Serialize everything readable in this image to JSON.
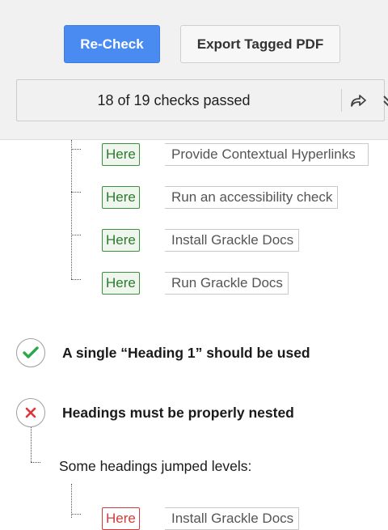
{
  "toolbar": {
    "recheck_label": "Re-Check",
    "export_label": "Export Tagged PDF"
  },
  "summary": {
    "text": "18 of 19 checks passed"
  },
  "links": [
    {
      "here": "Here",
      "label": "Provide Contextual Hyperlinks"
    },
    {
      "here": "Here",
      "label": "Run an accessibility check"
    },
    {
      "here": "Here",
      "label": "Install Grackle Docs"
    },
    {
      "here": "Here",
      "label": "Run Grackle Docs"
    }
  ],
  "checks": [
    {
      "status": "pass",
      "title": "A single “Heading 1” should be used"
    },
    {
      "status": "fail",
      "title": "Headings must be properly nested",
      "detail": "Some headings jumped levels:"
    }
  ],
  "fail_links": [
    {
      "here": "Here",
      "label": "Install Grackle Docs"
    }
  ],
  "colors": {
    "primary": "#4a8bf1",
    "pass": "#2aa84a",
    "fail": "#d9363e"
  }
}
